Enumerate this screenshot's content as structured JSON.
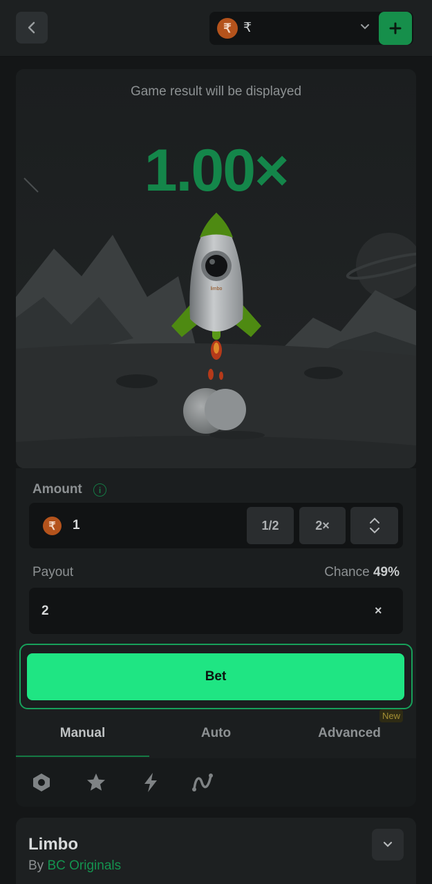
{
  "topbar": {
    "back_icon": "chevron-left-icon",
    "currency_symbol_badge": "₹",
    "currency_symbol": "₹",
    "add_icon": "plus-icon"
  },
  "game": {
    "result_text": "Game result will be displayed",
    "multiplier": "1.00×",
    "rocket_label": "limbo"
  },
  "bet_panel": {
    "amount_label": "Amount",
    "info_icon": "i",
    "amount_coin": "₹",
    "amount_value": "1",
    "half_label": "1/2",
    "double_label": "2×",
    "payout_label": "Payout",
    "chance_label": "Chance",
    "chance_value": "49%",
    "payout_value": "2",
    "payout_suffix": "×",
    "bet_label": "Bet",
    "colors": {
      "bet": "#1fe583",
      "accent": "#157a44"
    }
  },
  "tabs": [
    {
      "label": "Manual",
      "active": true
    },
    {
      "label": "Auto",
      "active": false
    },
    {
      "label": "Advanced",
      "active": false
    }
  ],
  "new_badge": "New",
  "tools": [
    "hexagon-icon",
    "star-icon",
    "lightning-icon",
    "curve-icon"
  ],
  "info": {
    "title": "Limbo",
    "by_prefix": "By",
    "by_link": "BC Originals"
  }
}
